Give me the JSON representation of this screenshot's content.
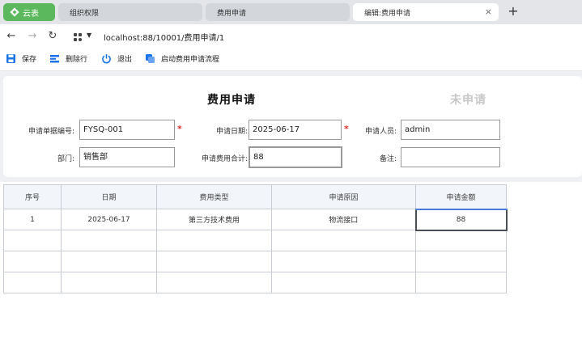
{
  "browser": {
    "app_tab": "云表",
    "tabs": [
      {
        "label": "组织权限"
      },
      {
        "label": "费用申请"
      },
      {
        "label": "编辑:费用申请"
      }
    ],
    "new_tab": "+",
    "close": "×",
    "url": "localhost:88/10001/费用申请/1"
  },
  "toolbar": {
    "save": "保存",
    "delete_row": "删除行",
    "exit": "退出",
    "start_flow": "启动费用申请流程"
  },
  "form": {
    "title": "费用申请",
    "status": "未申请",
    "fields": {
      "doc_no": {
        "label": "申请单据编号:",
        "value": "FYSQ-001"
      },
      "date": {
        "label": "申请日期:",
        "value": "2025-06-17"
      },
      "applicant": {
        "label": "申请人员:",
        "value": "admin"
      },
      "dept": {
        "label": "部门:",
        "value": "销售部"
      },
      "total": {
        "label": "申请费用合计:",
        "value": "88"
      },
      "remark": {
        "label": "备注:",
        "value": ""
      }
    },
    "required_mark": "*"
  },
  "table": {
    "headers": [
      "序号",
      "日期",
      "费用类型",
      "申请原因",
      "申请金额"
    ],
    "rows": [
      [
        "1",
        "2025-06-17",
        "第三方技术费用",
        "物流接口",
        "88"
      ],
      [
        "",
        "",
        "",
        "",
        ""
      ],
      [
        "",
        "",
        "",
        "",
        ""
      ],
      [
        "",
        "",
        "",
        "",
        ""
      ]
    ]
  },
  "colors": {
    "app_tab": "#5cb85c",
    "required": "#d9302c",
    "toolbar_icon": "#1a73e8"
  }
}
